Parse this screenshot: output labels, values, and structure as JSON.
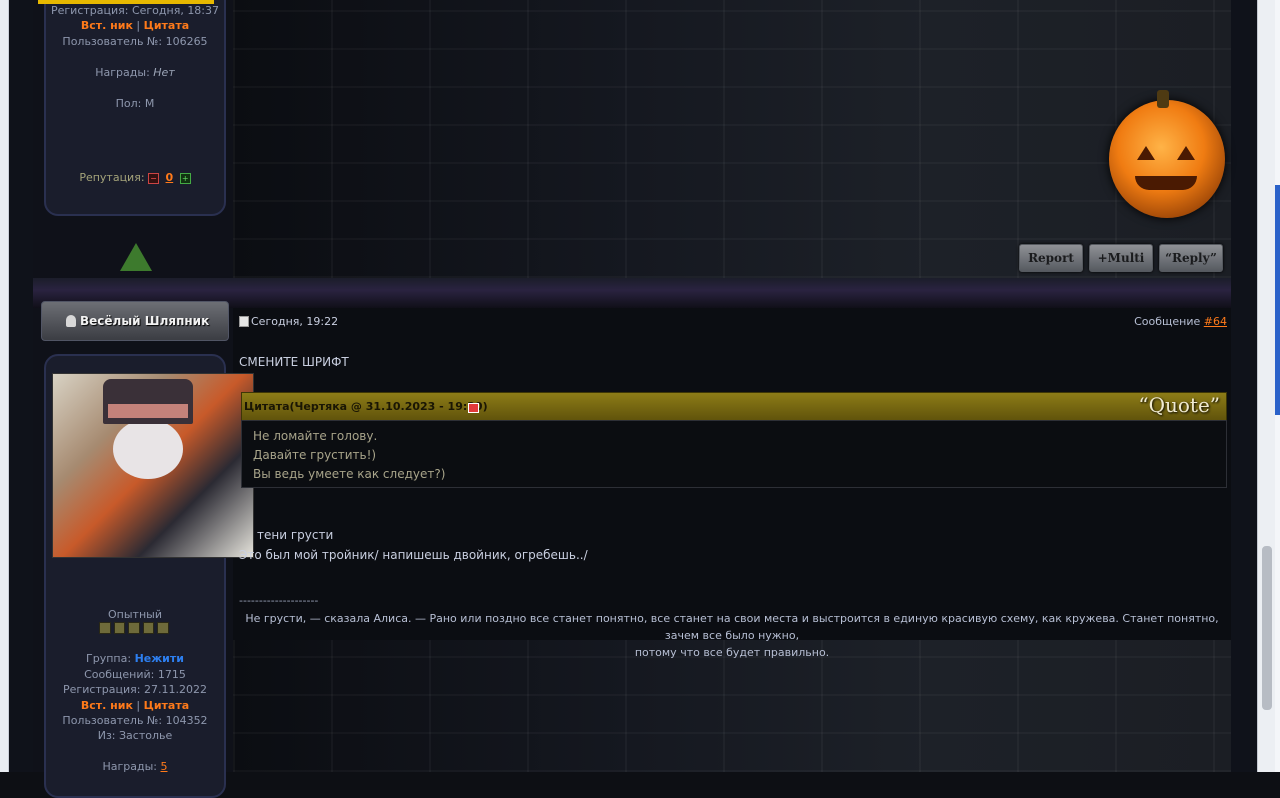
{
  "upper_profile": {
    "registration": "Регистрация: Сегодня, 18:37",
    "insert_nick": "Вст. ник",
    "separator": "|",
    "quote_link": "Цитата",
    "user_number": "Пользователь №: 106265",
    "awards_label": "Награды:",
    "awards_value": "Нет",
    "gender": "Пол: М",
    "reputation_label": "Репутация:",
    "reputation_value": "0"
  },
  "upper_post_buttons": {
    "report": "Report",
    "multi": "+Multi",
    "reply": "“Reply”"
  },
  "post": {
    "author_nick": "Весёлый Шляпник",
    "date": "Сегодня, 19:22",
    "message_label": "Сообщение",
    "message_number": "#64",
    "headline": "СМЕНИТЕ ШРИФТ",
    "quote": {
      "header": "Цитата(Чертяка @ 31.10.2023 - 19:20)",
      "badge": "“Quote”",
      "lines": [
        "Не ломайте голову.",
        "Давайте грустить!)",
        "Вы ведь умеете как следует?)"
      ]
    },
    "reply_line1": "тени грусти",
    "reply_line2": "Это был мой тройник/ напишешь двойник, огребешь../",
    "signature_divider": "--------------------",
    "signature_line1": "Не грусти, — сказала Алиса. — Рано или поздно все станет понятно, все станет на свои места и выстроится в единую красивую схему, как кружева. Станет понятно, зачем все было нужно,",
    "signature_line2": "потому что все будет правильно."
  },
  "lower_profile": {
    "rank": "Опытный",
    "group_label": "Группа:",
    "group_value": "Нежити",
    "messages": "Сообщений: 1715",
    "registration": "Регистрация: 27.11.2022",
    "insert_nick": "Вст. ник",
    "separator": "|",
    "quote_link": "Цитата",
    "user_number": "Пользователь №: 104352",
    "location": "Из: Застолье",
    "awards_label": "Награды:",
    "awards_value": "5"
  },
  "colors": {
    "accent_orange": "#ff7a1a",
    "group_blue": "#2d7ff0",
    "quote_gold": "#7a6a12"
  }
}
